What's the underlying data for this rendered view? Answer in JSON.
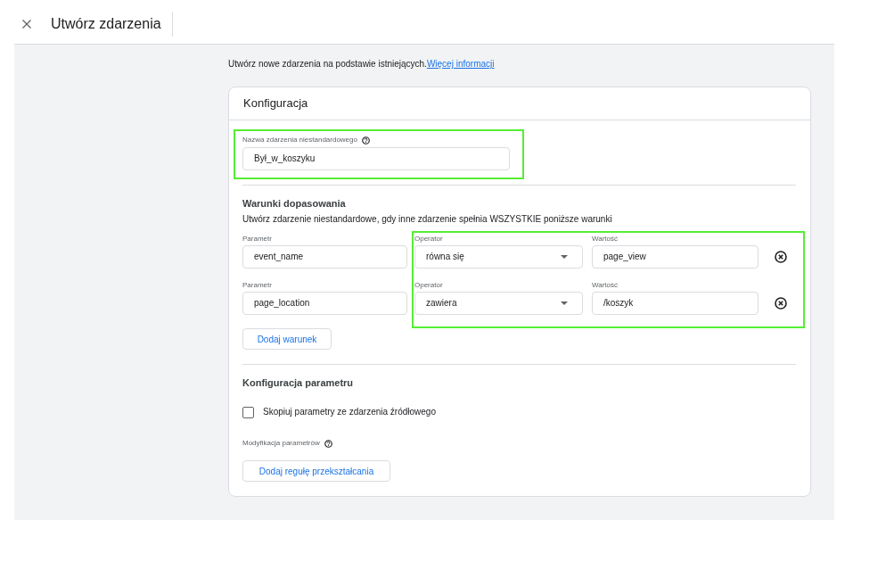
{
  "header": {
    "title": "Utwórz zdarzenia"
  },
  "intro": {
    "text": "Utwórz nowe zdarzenia na podstawie istniejących.",
    "link": "Więcej informacji"
  },
  "card": {
    "title": "Konfiguracja",
    "custom_event_name": {
      "label": "Nazwa zdarzenia niestandardowego",
      "value": "Był_w_koszyku",
      "highlighted": true
    },
    "matching_conditions": {
      "title": "Warunki dopasowania",
      "description": "Utwórz zdarzenie niestandardowe, gdy inne zdarzenie spełnia WSZYSTKIE poniższe warunki",
      "highlighted": true,
      "rows": [
        {
          "parameter_label": "Parametr",
          "parameter": "event_name",
          "operator_label": "Operator",
          "operator": "równa się",
          "value_label": "Wartość",
          "value": "page_view"
        },
        {
          "parameter_label": "Parametr",
          "parameter": "page_location",
          "operator_label": "Operator",
          "operator": "zawiera",
          "value_label": "Wartość",
          "value": "/koszyk"
        }
      ],
      "add_button": "Dodaj warunek"
    },
    "parameter_configuration": {
      "title": "Konfiguracja parametru",
      "copy_checkbox": {
        "label": "Skopiuj parametry ze zdarzenia źródłowego",
        "checked": false
      },
      "modification_label": "Modyfikacja parametrów",
      "add_rule_button": "Dodaj regułę przekształcania"
    }
  }
}
